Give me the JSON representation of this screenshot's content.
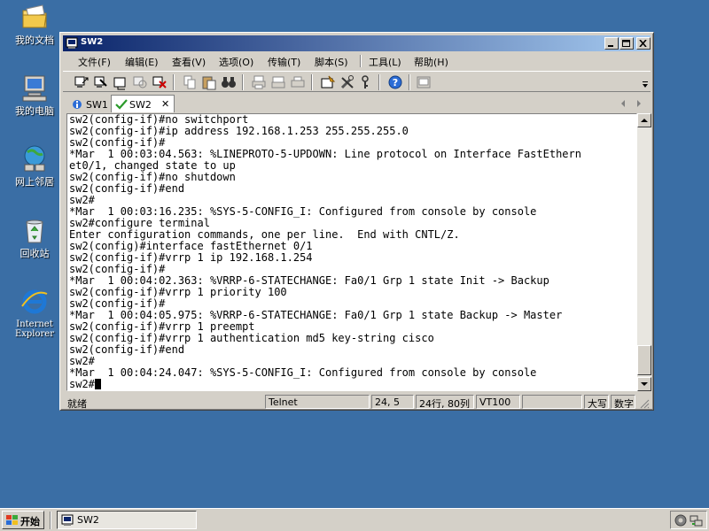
{
  "desktop": {
    "icons": [
      {
        "label": "我的文档"
      },
      {
        "label": "我的电脑"
      },
      {
        "label": "网上邻居"
      },
      {
        "label": "回收站"
      },
      {
        "label_line1": "Internet",
        "label_line2": "Explorer"
      }
    ]
  },
  "window": {
    "title": "SW2",
    "menu": [
      "文件(F)",
      "编辑(E)",
      "查看(V)",
      "选项(O)",
      "传输(T)",
      "脚本(S)",
      "工具(L)",
      "帮助(H)"
    ],
    "tabs": [
      {
        "label": "SW1"
      },
      {
        "label": "SW2",
        "close": "✕"
      }
    ],
    "terminal_lines": [
      "sw2(config-if)#no switchport",
      "sw2(config-if)#ip address 192.168.1.253 255.255.255.0",
      "sw2(config-if)#",
      "*Mar  1 00:03:04.563: %LINEPROTO-5-UPDOWN: Line protocol on Interface FastEthern",
      "et0/1, changed state to up",
      "sw2(config-if)#no shutdown",
      "sw2(config-if)#end",
      "sw2#",
      "*Mar  1 00:03:16.235: %SYS-5-CONFIG_I: Configured from console by console",
      "sw2#configure terminal",
      "Enter configuration commands, one per line.  End with CNTL/Z.",
      "sw2(config)#interface fastEthernet 0/1",
      "sw2(config-if)#vrrp 1 ip 192.168.1.254",
      "sw2(config-if)#",
      "*Mar  1 00:04:02.363: %VRRP-6-STATECHANGE: Fa0/1 Grp 1 state Init -> Backup",
      "sw2(config-if)#vrrp 1 priority 100",
      "sw2(config-if)#",
      "*Mar  1 00:04:05.975: %VRRP-6-STATECHANGE: Fa0/1 Grp 1 state Backup -> Master",
      "sw2(config-if)#vrrp 1 preempt",
      "sw2(config-if)#vrrp 1 authentication md5 key-string cisco",
      "sw2(config-if)#end",
      "sw2#",
      "*Mar  1 00:04:24.047: %SYS-5-CONFIG_I: Configured from console by console"
    ],
    "prompt": "sw2#",
    "status": {
      "ready": "就绪",
      "protocol": "Telnet",
      "cursor_pos": "24,  5",
      "size": "24行, 80列",
      "emulation": "VT100",
      "empty": "",
      "caps": "大写",
      "num": "数字"
    }
  },
  "taskbar": {
    "start_label": "开始",
    "task_label": "SW2"
  }
}
